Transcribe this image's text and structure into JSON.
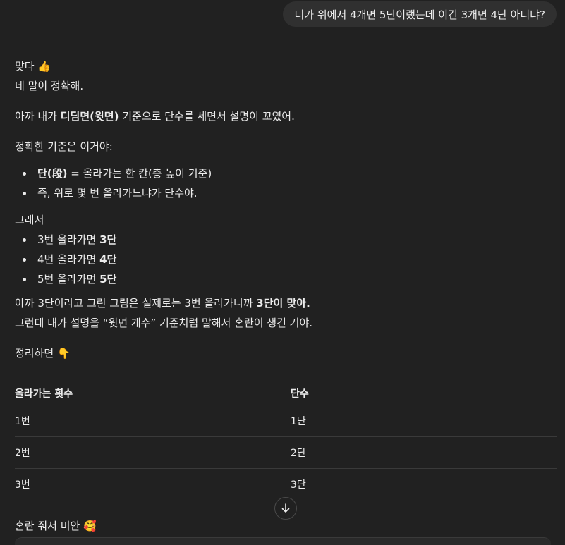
{
  "user_message": "너가 위에서 4개면 5단이랬는데 이건 3개면 4단 아니냐?",
  "answer": {
    "p1": "맞다",
    "p1_emoji": "👍",
    "p2": "네 말이 정확해.",
    "p3_before": "아까 내가 ",
    "p3_bold": "디딤면(윗면)",
    "p3_after": " 기준으로 단수를 세면서 설명이 꼬였어.",
    "p4": "정확한 기준은 이거야:",
    "bullets1": [
      {
        "bold": "단(段)",
        "text": " = 올라가는 한 칸(층 높이 기준)"
      },
      {
        "bold": "",
        "text": "즉, 위로 몇 번 올라가느냐가 단수야."
      }
    ],
    "p5": "그래서",
    "bullets2": [
      {
        "text": "3번 올라가면 ",
        "bold": "3단"
      },
      {
        "text": "4번 올라가면 ",
        "bold": "4단"
      },
      {
        "text": "5번 올라가면 ",
        "bold": "5단"
      }
    ],
    "p6_before": "아까 3단이라고 그린 그림은 실제로는 3번 올라가니까 ",
    "p6_bold": "3단이 맞아.",
    "p7": "그런데 내가 설명을 “윗면 개수” 기준처럼 말해서 혼란이 생긴 거야.",
    "p8": "정리하면",
    "p8_emoji": "👇"
  },
  "table": {
    "headers": [
      "올라가는 횟수",
      "단수"
    ],
    "rows": [
      [
        "1번",
        "1단"
      ],
      [
        "2번",
        "2단"
      ],
      [
        "3번",
        "3단"
      ]
    ]
  },
  "closing": "혼란 줘서 미안",
  "closing_emoji": "🥰",
  "icons": {
    "scroll_down": "arrow-down-icon"
  }
}
